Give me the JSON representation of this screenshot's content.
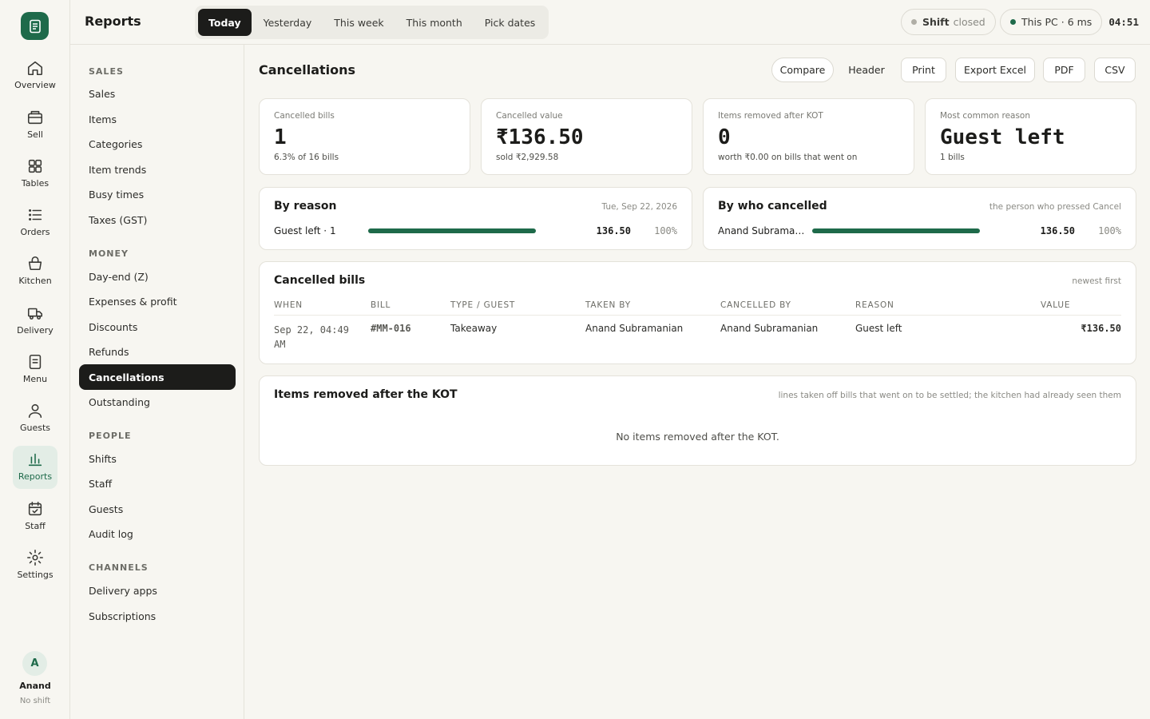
{
  "app": {
    "user": {
      "initial": "A",
      "name": "Anand",
      "status": "No shift"
    }
  },
  "rail": [
    {
      "label": "Overview",
      "icon": "home-icon"
    },
    {
      "label": "Sell",
      "icon": "register-icon"
    },
    {
      "label": "Tables",
      "icon": "grid-icon"
    },
    {
      "label": "Orders",
      "icon": "list-icon"
    },
    {
      "label": "Kitchen",
      "icon": "basket-icon"
    },
    {
      "label": "Delivery",
      "icon": "truck-icon"
    },
    {
      "label": "Menu",
      "icon": "menu-icon"
    },
    {
      "label": "Guests",
      "icon": "person-icon"
    },
    {
      "label": "Reports",
      "icon": "chart-icon",
      "active": true
    },
    {
      "label": "Staff",
      "icon": "calendar-icon"
    },
    {
      "label": "Settings",
      "icon": "gear-icon"
    }
  ],
  "topbar": {
    "title": "Reports",
    "ranges": [
      "Today",
      "Yesterday",
      "This week",
      "This month",
      "Pick dates"
    ],
    "active_range": "Today",
    "shift": {
      "label": "Shift",
      "state": "closed"
    },
    "device": "This PC · 6 ms",
    "clock": "04:51"
  },
  "subnav": {
    "groups": [
      {
        "heading": "SALES",
        "items": [
          "Sales",
          "Items",
          "Categories",
          "Item trends",
          "Busy times",
          "Taxes (GST)"
        ]
      },
      {
        "heading": "MONEY",
        "items": [
          "Day-end (Z)",
          "Expenses & profit",
          "Discounts",
          "Refunds",
          "Cancellations",
          "Outstanding"
        ]
      },
      {
        "heading": "PEOPLE",
        "items": [
          "Shifts",
          "Staff",
          "Guests",
          "Audit log"
        ]
      },
      {
        "heading": "CHANNELS",
        "items": [
          "Delivery apps",
          "Subscriptions"
        ]
      }
    ],
    "active": "Cancellations"
  },
  "main": {
    "title": "Cancellations",
    "actions": {
      "compare": "Compare",
      "header": "Header",
      "print": "Print",
      "excel": "Export Excel",
      "pdf": "PDF",
      "csv": "CSV"
    },
    "kpis": [
      {
        "label": "Cancelled bills",
        "value": "1",
        "sub": "6.3% of 16 bills"
      },
      {
        "label": "Cancelled value",
        "value": "₹136.50",
        "sub": "sold ₹2,929.58"
      },
      {
        "label": "Items removed after KOT",
        "value": "0",
        "sub": "worth ₹0.00 on bills that went on"
      },
      {
        "label": "Most common reason",
        "value": "Guest left",
        "sub": "1 bills"
      }
    ],
    "by_reason": {
      "title": "By reason",
      "note": "Tue, Sep 22, 2026",
      "rows": [
        {
          "label": "Guest left · 1",
          "value": "136.50",
          "pct": "100%",
          "fraction": 1.0
        }
      ]
    },
    "by_who": {
      "title": "By who cancelled",
      "note": "the person who pressed Cancel",
      "rows": [
        {
          "label": "Anand Subramanian",
          "value": "136.50",
          "pct": "100%",
          "fraction": 1.0
        }
      ]
    },
    "cancelled_bills": {
      "title": "Cancelled bills",
      "note": "newest first",
      "columns": [
        "WHEN",
        "BILL",
        "TYPE / GUEST",
        "TAKEN BY",
        "CANCELLED BY",
        "REASON",
        "VALUE"
      ],
      "rows": [
        {
          "when": "Sep 22, 04:49 AM",
          "bill": "#MM-016",
          "type": "Takeaway",
          "taken_by": "Anand Subramanian",
          "cancelled_by": "Anand Subramanian",
          "reason": "Guest left",
          "value": "₹136.50"
        }
      ]
    },
    "removed_items": {
      "title": "Items removed after the KOT",
      "note": "lines taken off bills that went on to be settled; the kitchen had already seen them",
      "empty": "No items removed after the KOT."
    }
  }
}
